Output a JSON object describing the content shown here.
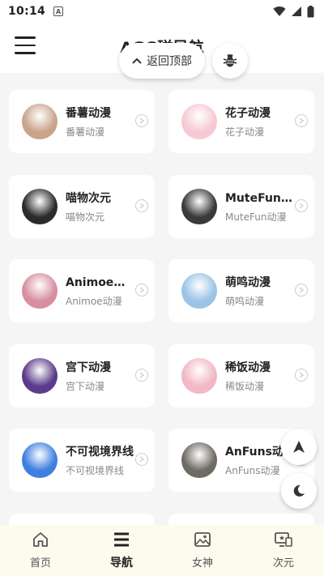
{
  "status_bar": {
    "time": "10:14",
    "app_indicator": "A"
  },
  "header": {
    "title": "AGG磁导航",
    "back_to_top_label": "返回顶部"
  },
  "sites": [
    {
      "name": "番薯动漫",
      "subtitle": "番薯动漫",
      "avatar_color": "#c9a48b"
    },
    {
      "name": "花子动漫",
      "subtitle": "花子动漫",
      "avatar_color": "#f7c9d4"
    },
    {
      "name": "喵物次元",
      "subtitle": "喵物次元",
      "avatar_color": "#2b2b2b"
    },
    {
      "name": "MuteFun动漫",
      "subtitle": "MuteFun动漫",
      "avatar_color": "#3a3a3a"
    },
    {
      "name": "Animoe动漫",
      "subtitle": "Animoe动漫",
      "avatar_color": "#d88ea0"
    },
    {
      "name": "萌鸣动漫",
      "subtitle": "萌鸣动漫",
      "avatar_color": "#9bc4e6"
    },
    {
      "name": "宫下动漫",
      "subtitle": "宫下动漫",
      "avatar_color": "#5a3c8a"
    },
    {
      "name": "稀饭动漫",
      "subtitle": "稀饭动漫",
      "avatar_color": "#f2b8c3"
    },
    {
      "name": "不可视境界线",
      "subtitle": "不可视境界线",
      "avatar_color": "#3f7fe0"
    },
    {
      "name": "AnFuns动漫",
      "subtitle": "AnFuns动漫",
      "avatar_color": "#6e6a64"
    }
  ],
  "bottom_nav": [
    {
      "label": "首页",
      "icon": "home-icon"
    },
    {
      "label": "导航",
      "icon": "nav-list-icon"
    },
    {
      "label": "女神",
      "icon": "gallery-icon"
    },
    {
      "label": "次元",
      "icon": "dimension-icon"
    }
  ],
  "active_nav_index": 1
}
